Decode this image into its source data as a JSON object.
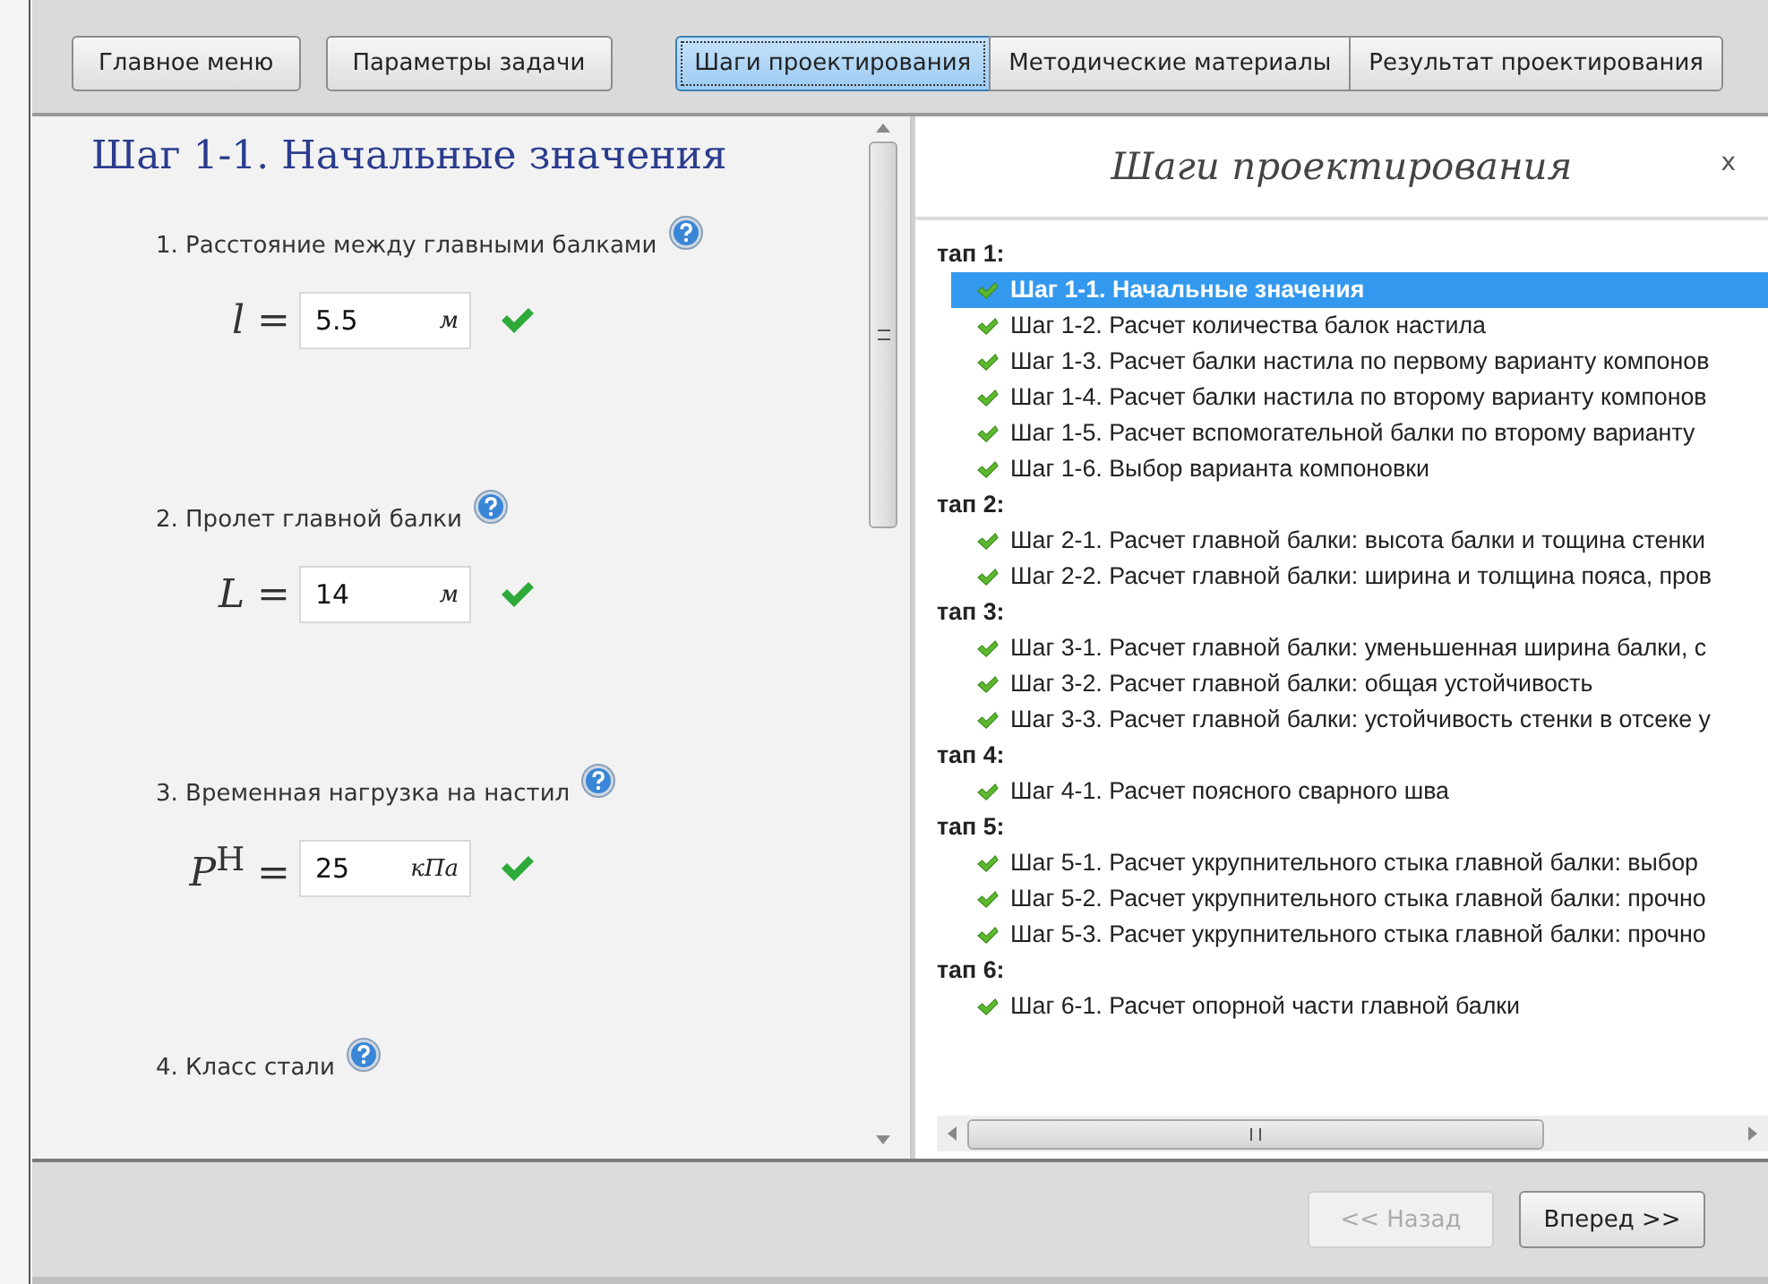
{
  "toolbar": {
    "buttons": [
      "Главное меню",
      "Параметры задачи"
    ],
    "tabs": [
      {
        "label": "Шаги проектирования",
        "selected": true
      },
      {
        "label": "Методические материалы",
        "selected": false
      },
      {
        "label": "Результат проектирования",
        "selected": false
      }
    ]
  },
  "step": {
    "title": "Шаг 1-1. Начальные значения",
    "params": [
      {
        "label": "1.  Расстояние между главными балками",
        "formula": "*l* =",
        "value": "5.5",
        "unit": "м",
        "valid": true
      },
      {
        "label": "2.  Пролет главной балки",
        "formula": "*L* =",
        "value": "14",
        "unit": "м",
        "valid": true
      },
      {
        "label": "3.  Временная нагрузка на настил",
        "formula": "*P*$^{H}$ =",
        "value": "25",
        "unit": "кПа",
        "valid": true
      },
      {
        "label": "4.  Класс стали"
      }
    ]
  },
  "steps_panel": {
    "title": "Шаги проектирования",
    "close": "x",
    "stages": [
      {
        "label": "тап 1:",
        "children": [
          {
            "label": "Шаг 1-1. Начальные значения",
            "done": true,
            "selected": true
          },
          {
            "label": "Шаг 1-2. Расчет количества балок настила",
            "done": true,
            "selected": false
          },
          {
            "label": "Шаг 1-3. Расчет балки настила по первому варианту компонов",
            "done": true,
            "selected": false
          },
          {
            "label": "Шаг 1-4. Расчет балки настила по второму варианту компонов",
            "done": true,
            "selected": false
          },
          {
            "label": "Шаг 1-5. Расчет вспомогательной балки по второму варианту",
            "done": true,
            "selected": false
          },
          {
            "label": "Шаг 1-6. Выбор варианта компоновки",
            "done": true,
            "selected": false
          }
        ]
      },
      {
        "label": "тап 2:",
        "children": [
          {
            "label": "Шаг 2-1. Расчет главной балки: высота балки и тощина стенки",
            "done": true,
            "selected": false
          },
          {
            "label": "Шаг 2-2. Расчет главной балки: ширина и толщина пояса, пров",
            "done": true,
            "selected": false
          }
        ]
      },
      {
        "label": "тап 3:",
        "children": [
          {
            "label": "Шаг 3-1. Расчет главной балки: уменьшенная ширина балки, с",
            "done": true,
            "selected": false
          },
          {
            "label": "Шаг 3-2. Расчет главной балки: общая устойчивость",
            "done": true,
            "selected": false
          },
          {
            "label": "Шаг 3-3. Расчет главной балки: устойчивость стенки в отсеке у",
            "done": true,
            "selected": false
          }
        ]
      },
      {
        "label": "тап 4:",
        "children": [
          {
            "label": "Шаг 4-1. Расчет поясного сварного шва",
            "done": true,
            "selected": false
          }
        ]
      },
      {
        "label": "тап 5:",
        "children": [
          {
            "label": "Шаг 5-1. Расчет укрупнительного стыка главной балки: выбор",
            "done": true,
            "selected": false
          },
          {
            "label": "Шаг 5-2. Расчет укрупнительного стыка главной балки: прочно",
            "done": true,
            "selected": false
          },
          {
            "label": "Шаг 5-3. Расчет укрупнительного стыка главной балки: прочно",
            "done": true,
            "selected": false
          }
        ]
      },
      {
        "label": "тап 6:",
        "children": [
          {
            "label": "Шаг 6-1. Расчет опорной части главной балки",
            "done": true,
            "selected": false
          }
        ]
      }
    ]
  },
  "footer": {
    "buttons": [
      {
        "label": "<< Назад",
        "disabled": true
      },
      {
        "label": "Вперед >>",
        "disabled": false
      }
    ]
  }
}
